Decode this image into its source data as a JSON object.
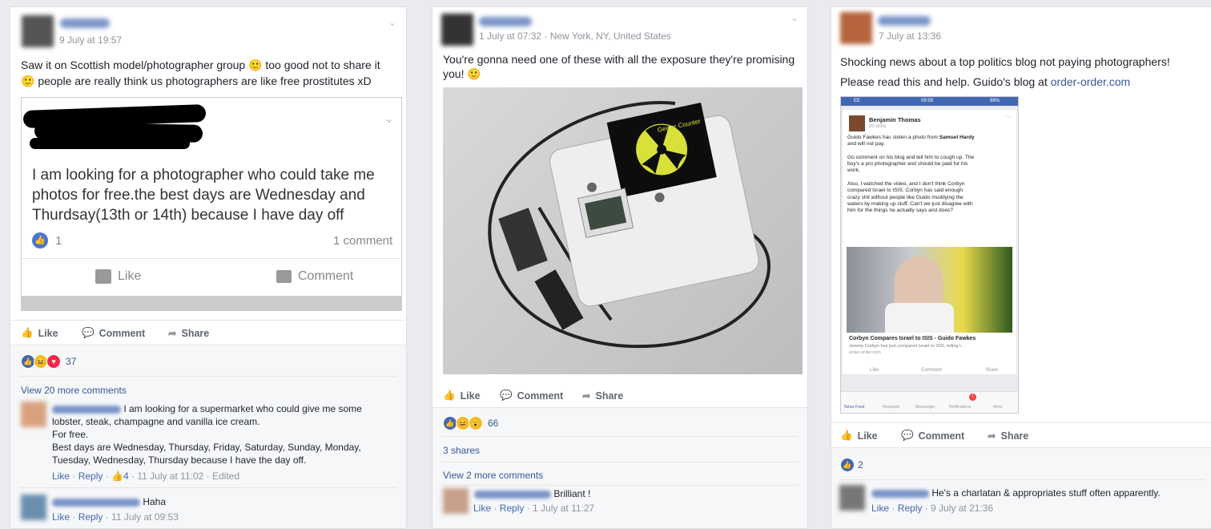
{
  "posts": [
    {
      "timestamp": "9 July at 19:57",
      "text_line1": "Saw it on Scottish model/photographer group 🙂 too good not to share it",
      "text_line2": "🙂 people are really think us photographers are like free prostitutes xD",
      "embedded": {
        "text_line1": "I am looking for a photographer who could take me",
        "text_line2": "photos for free.the best days are Wednesday and",
        "text_line3": "Thurdsay(13th or 14th) because I have day off",
        "like_count": "1",
        "comment_count": "1 comment",
        "like_label": "Like",
        "comment_label": "Comment"
      },
      "actions": {
        "like": "Like",
        "comment": "Comment",
        "share": "Share"
      },
      "reaction_count": "37",
      "view_more": "View 20 more comments",
      "comments": [
        {
          "lines": [
            "I am looking for a supermarket who could give me some",
            "lobster, steak, champagne and vanilla ice cream.",
            "For free.",
            "Best days are Wednesday, Thursday, Friday, Saturday, Sunday, Monday,",
            "Tuesday, Wednesday, Thursday because I have the day off."
          ],
          "like": "Like",
          "reply": "Reply",
          "likes": "4",
          "time": "11 July at 11:02",
          "edited": "Edited"
        },
        {
          "lines": [
            "Haha"
          ],
          "like": "Like",
          "reply": "Reply",
          "time": "11 July at 09:53"
        }
      ]
    },
    {
      "timestamp": "1 July at 07:32 · New York, NY, United States",
      "text_line1": "You're gonna need one of these with all the exposure they're promising",
      "text_line2": "you! 🙂",
      "device_label": "Geiger Counter",
      "actions": {
        "like": "Like",
        "comment": "Comment",
        "share": "Share"
      },
      "reaction_count": "66",
      "shares": "3 shares",
      "view_more": "View 2 more comments",
      "comments": [
        {
          "lines": [
            "Brilliant !"
          ],
          "like": "Like",
          "reply": "Reply",
          "time": "1 July at 11:27"
        }
      ]
    },
    {
      "timestamp": "7 July at 13:36",
      "text_line1": "Shocking news about a top politics blog not paying photographers!",
      "text_line2_prefix": "Please read this and help. Guido's blog at ",
      "text_line2_link": "order-order.com",
      "phone": {
        "carrier": "EE",
        "time": "09:59",
        "battery": "88%",
        "author": "Benjamin Thomas",
        "age": "20 mins",
        "p1a": "Guido Fawkes has stolen a photo from ",
        "p1b": "Samuel Hardy",
        "p1c": "and will not pay.",
        "p2": [
          "Go comment on his blog and tell him to cough up. The",
          "boy's a pro photographer and should be paid for his",
          "work."
        ],
        "p3": [
          "Also, I watched the video, and I don't think Corbyn",
          "compared Israel to ISIS. Corbyn has said enough",
          "crazy shit without people like Guido muddying the",
          "waters by making up stuff. Can't we just disagree with",
          "him for the things he actually says and does?"
        ],
        "link_title": "Corbyn Compares Israel to ISIS - Guido Fawkes",
        "link_desc": "Jeremy Corbyn has just compared Israel to ISIS, telling t...",
        "link_domain": "order-order.com",
        "like": "Like",
        "comment": "Comment",
        "share": "Share",
        "tabs": [
          "News Feed",
          "Requests",
          "Messenger",
          "Notifications",
          "More"
        ],
        "notif_badge": "1"
      },
      "actions": {
        "like": "Like",
        "comment": "Comment",
        "share": "Share"
      },
      "reaction_count": "2",
      "comments": [
        {
          "lines": [
            "He's a charlatan & appropriates stuff often apparently."
          ],
          "like": "Like",
          "reply": "Reply",
          "time": "9 July at 21:36"
        }
      ]
    }
  ],
  "colors": {
    "like_blue": "#4267b2",
    "haha_yellow": "#f7b928",
    "love_red": "#f0284a",
    "link": "#365899"
  }
}
